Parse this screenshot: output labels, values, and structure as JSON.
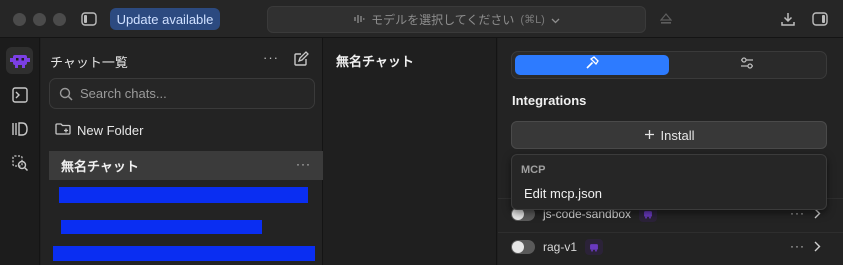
{
  "titlebar": {
    "update_label": "Update available",
    "model_select_placeholder": "モデルを選択してください",
    "model_select_shortcut": "(⌘L)"
  },
  "rail": {
    "items": [
      {
        "icon": "assistant-mascot-icon",
        "active": true
      },
      {
        "icon": "terminal-icon",
        "active": false
      },
      {
        "icon": "library-icon",
        "active": false
      },
      {
        "icon": "search-discover-icon",
        "active": false
      }
    ]
  },
  "chatlist": {
    "title": "チャット一覧",
    "more_label": "···",
    "search_placeholder": "Search chats...",
    "new_folder_label": "New Folder",
    "selected_chat": "無名チャット",
    "row_more": "···"
  },
  "chat": {
    "title": "無名チャット"
  },
  "right_panel": {
    "integrations_title": "Integrations",
    "install_label": "Install",
    "dropdown": {
      "header": "MCP",
      "item": "Edit mcp.json"
    },
    "rows": [
      {
        "name": "js-code-sandbox",
        "enabled": false
      },
      {
        "name": "rag-v1",
        "enabled": false
      }
    ],
    "row_more": "···"
  },
  "colors": {
    "accent": "#2d7bff",
    "redaction": "#0a2ef2",
    "mascot": "#7b3fe4"
  }
}
